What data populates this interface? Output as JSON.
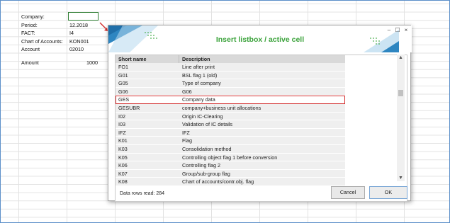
{
  "spreadsheet": {
    "labels": [
      {
        "text": "Company:"
      },
      {
        "text": "Period:"
      },
      {
        "text": "FACT:"
      },
      {
        "text": "Chart of Accounts:"
      },
      {
        "text": "Account"
      },
      {
        "text": "Amount"
      }
    ],
    "values": [
      {
        "text": ""
      },
      {
        "text": "12.2018"
      },
      {
        "text": "I4"
      },
      {
        "text": "KON001"
      },
      {
        "text": "02010"
      },
      {
        "text": "1000"
      }
    ]
  },
  "dialog": {
    "title": "Insert listbox / active cell",
    "controls": {
      "minimize": "–",
      "maximize": "☐",
      "close": "×"
    },
    "columns": {
      "short_name": "Short name",
      "description": "Description"
    },
    "rows": [
      {
        "short": "FO1",
        "desc": "Line after print",
        "selected": false
      },
      {
        "short": "G01",
        "desc": "BSL flag 1 (old)",
        "selected": false
      },
      {
        "short": "G05",
        "desc": "Type of company",
        "selected": false
      },
      {
        "short": "G06",
        "desc": "G06",
        "selected": false
      },
      {
        "short": "GES",
        "desc": "Company data",
        "selected": true
      },
      {
        "short": "GESUBR",
        "desc": "company+business unit allocations",
        "selected": false
      },
      {
        "short": "I02",
        "desc": "Origin IC-Clearing",
        "selected": false
      },
      {
        "short": "I03",
        "desc": "Validation of IC details",
        "selected": false
      },
      {
        "short": "IFZ",
        "desc": "IFZ",
        "selected": false
      },
      {
        "short": "K01",
        "desc": "Flag",
        "selected": false
      },
      {
        "short": "K03",
        "desc": "Consolidation method",
        "selected": false
      },
      {
        "short": "K05",
        "desc": "Controlling object flag 1 before conversion",
        "selected": false
      },
      {
        "short": "K06",
        "desc": "Controlling flag 2",
        "selected": false
      },
      {
        "short": "K07",
        "desc": "Group/sub-group flag",
        "selected": false
      },
      {
        "short": "K08",
        "desc": "Chart of accounts/contr.obj. flag",
        "selected": false
      }
    ],
    "status": "Data rows read: 284",
    "cancel_label": "Cancel",
    "ok_label": "OK"
  },
  "colors": {
    "accent_green": "#3aa23a",
    "highlight_red": "#d32f2f",
    "frame_blue": "#5b8fc9"
  }
}
